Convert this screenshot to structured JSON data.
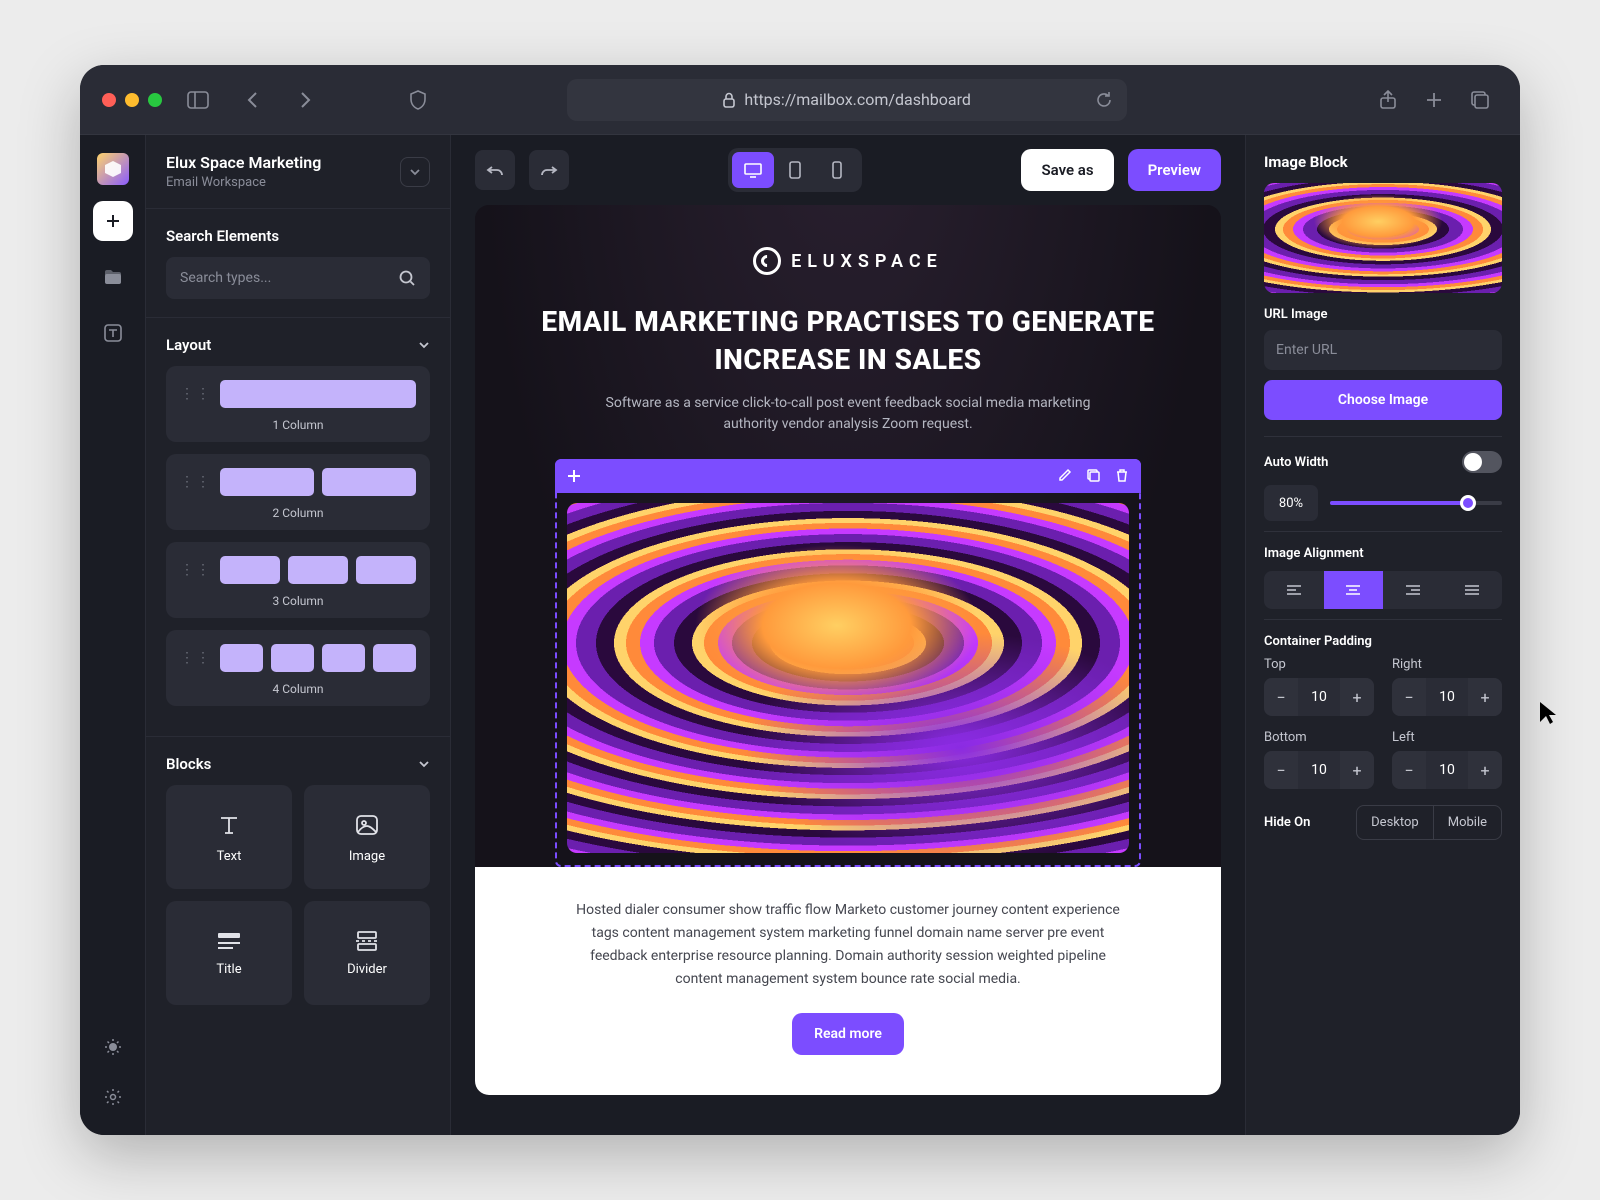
{
  "browser": {
    "url": "https://mailbox.com/dashboard"
  },
  "workspace": {
    "title": "Elux Space Marketing",
    "subtitle": "Email Workspace"
  },
  "search": {
    "heading": "Search Elements",
    "placeholder": "Search types..."
  },
  "layout": {
    "heading": "Layout",
    "items": [
      "1 Column",
      "2 Column",
      "3 Column",
      "4 Column"
    ]
  },
  "blocks": {
    "heading": "Blocks",
    "items": [
      "Text",
      "Image",
      "Title",
      "Divider"
    ]
  },
  "toolbar": {
    "save": "Save as",
    "preview": "Preview"
  },
  "email": {
    "brand": "ELUXSPACE",
    "headline": "EMAIL MARKETING PRACTISES TO GENERATE INCREASE IN SALES",
    "sub": "Software as a service click-to-call post event feedback social media marketing authority vendor analysis Zoom request.",
    "body": "Hosted dialer consumer show traffic flow Marketo customer journey content experience tags content management system marketing funnel domain name server pre event feedback enterprise resource planning. Domain authority session weighted pipeline content management system bounce rate social media.",
    "cta": "Read more"
  },
  "inspector": {
    "title": "Image Block",
    "url_label": "URL Image",
    "url_placeholder": "Enter URL",
    "choose": "Choose Image",
    "auto_width": "Auto Width",
    "width_pct": "80%",
    "alignment": "Image Alignment",
    "padding_title": "Container Padding",
    "padding": {
      "top_l": "Top",
      "right_l": "Right",
      "bottom_l": "Bottom",
      "left_l": "Left",
      "top": "10",
      "right": "10",
      "bottom": "10",
      "left": "10"
    },
    "hide_label": "Hide On",
    "hide_opts": [
      "Desktop",
      "Mobile"
    ]
  }
}
